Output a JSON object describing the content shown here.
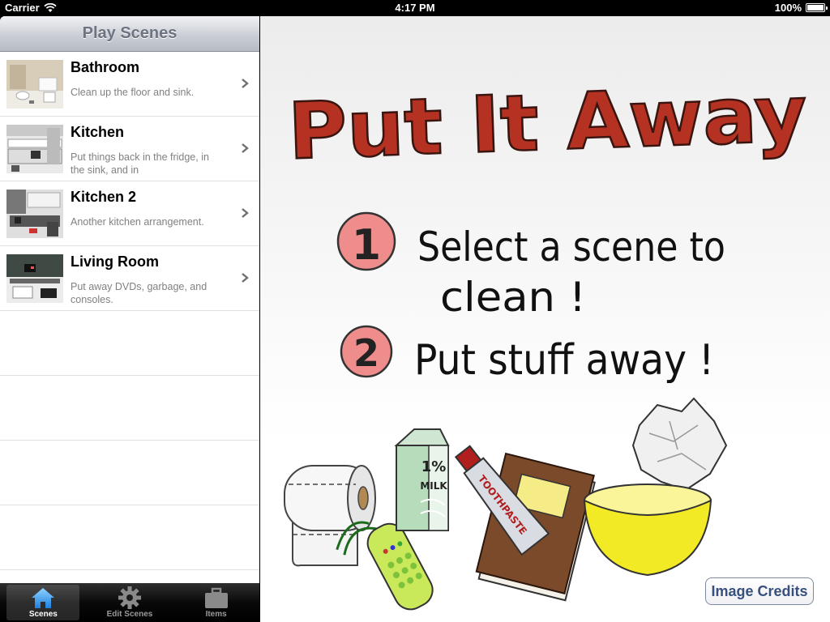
{
  "status_bar": {
    "carrier": "Carrier",
    "time": "4:17 PM",
    "battery": "100%"
  },
  "master": {
    "title": "Play Scenes",
    "scenes": [
      {
        "title": "Bathroom",
        "description": "Clean up the floor and sink."
      },
      {
        "title": "Kitchen",
        "description": "Put things back in the fridge, in the sink, and in"
      },
      {
        "title": "Kitchen 2",
        "description": "Another kitchen arrangement."
      },
      {
        "title": "Living Room",
        "description": "Put away DVDs, garbage, and consoles."
      }
    ]
  },
  "tabs": [
    {
      "label": "Scenes",
      "icon": "house-icon",
      "active": true
    },
    {
      "label": "Edit Scenes",
      "icon": "gear-icon",
      "active": false
    },
    {
      "label": "Items",
      "icon": "briefcase-icon",
      "active": false
    }
  ],
  "detail": {
    "title": "Put It Away",
    "steps": [
      {
        "number": "1",
        "text_line1": "Select a scene to",
        "text_line2": "clean !"
      },
      {
        "number": "2",
        "text_line1": "Put stuff away !",
        "text_line2": ""
      }
    ],
    "milk_label_1": "1%",
    "milk_label_2": "MILK",
    "toothpaste_label": "TOOTHPASTE",
    "credits_label": "Image Credits"
  },
  "colors": {
    "title_red": "#b53222",
    "step_circle": "#ef8c8c",
    "bowl_yellow": "#f3ea26",
    "book_brown": "#7a4a2a",
    "link_blue": "#37507f"
  }
}
